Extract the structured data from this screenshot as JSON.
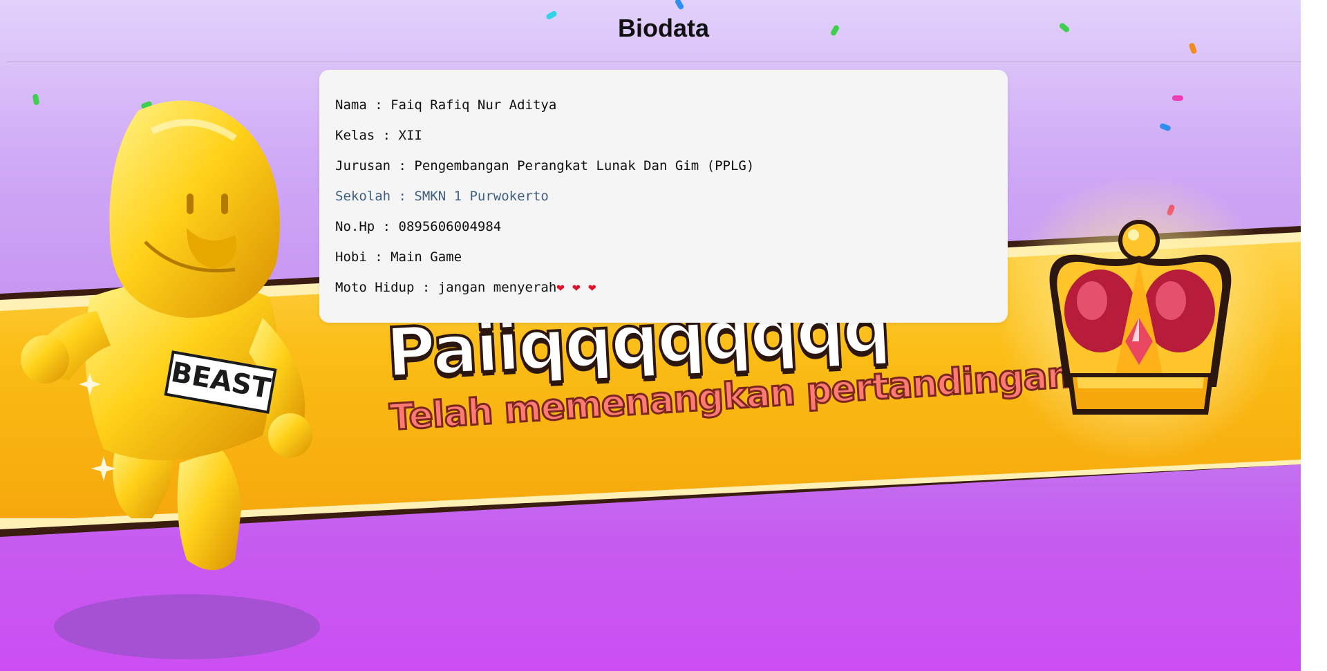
{
  "page": {
    "title": "Biodata"
  },
  "biodata": {
    "nama": "Nama : Faiq Rafiq Nur Aditya",
    "kelas": "Kelas : XII",
    "jurusan": "Jurusan : Pengembangan Perangkat Lunak Dan Gim (PPLG)",
    "sekolah": "Sekolah : SMKN 1 Purwokerto",
    "nohp": "No.Hp : 0895606004984",
    "hobi": "Hobi : Main Game",
    "moto": "Moto Hidup : jangan menyerah",
    "moto_hearts": "❤ ❤ ❤"
  },
  "banner": {
    "winner_name": "Paiiqqqqqqqq",
    "message": "Telah memenangkan pertandingan!",
    "badge_text": "BEAST"
  },
  "colors": {
    "banner_yellow": "#fbbd16",
    "message_pink": "#ff7a72",
    "school_link": "#3e5f7f",
    "heart": "#e0112b"
  },
  "icons": [
    "crown-icon",
    "heart-icon"
  ]
}
